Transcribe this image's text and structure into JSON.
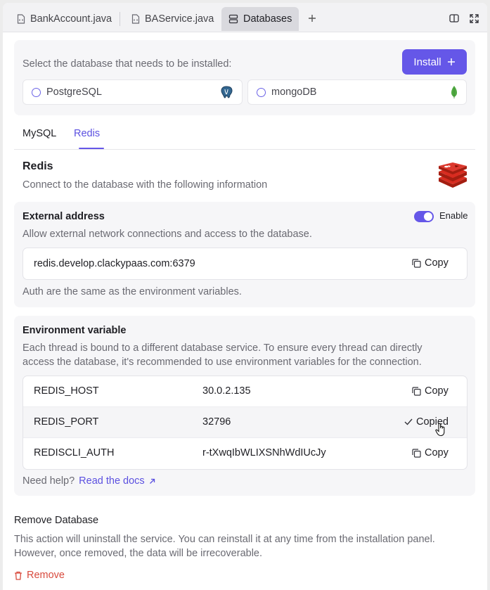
{
  "tabs": [
    {
      "label": "BankAccount.java",
      "icon": "file-code-icon"
    },
    {
      "label": "BAService.java",
      "icon": "file-code-icon"
    },
    {
      "label": "Databases",
      "icon": "database-icon"
    }
  ],
  "install": {
    "prompt": "Select the database that needs to be installed:",
    "button_label": "Install",
    "options": [
      {
        "label": "PostgreSQL",
        "icon": "postgresql-logo-icon"
      },
      {
        "label": "mongoDB",
        "icon": "mongodb-leaf-icon"
      }
    ]
  },
  "db_tabs": [
    "MySQL",
    "Redis"
  ],
  "selected_db_tab": "Redis",
  "redis": {
    "title": "Redis",
    "subtitle": "Connect to the database with the following information"
  },
  "external": {
    "title": "External address",
    "toggle_label": "Enable",
    "toggle_on": true,
    "description": "Allow external network connections and access to the database.",
    "address": "redis.develop.clackypaas.com:6379",
    "copy_label": "Copy",
    "note": "Auth are the same as the environment variables."
  },
  "env": {
    "title": "Environment variable",
    "description_line1": "Each thread is bound to a different database service. To ensure every thread can directly",
    "description_line2": "access the database, it's recommended to use environment variables for the connection.",
    "rows": [
      {
        "key": "REDIS_HOST",
        "value": "30.0.2.135",
        "action": "Copy"
      },
      {
        "key": "REDIS_PORT",
        "value": "32796",
        "action": "Copied"
      },
      {
        "key": "REDISCLI_AUTH",
        "value": "r-tXwqIbWLIXSNhWdIUcJy",
        "action": "Copy"
      }
    ],
    "help_text": "Need help?",
    "docs_link": "Read the docs"
  },
  "remove": {
    "title": "Remove Database",
    "description_line1": "This action will uninstall the service. You can reinstall it at any time from the installation panel.",
    "description_line2": "However, once removed, the data will be irrecoverable.",
    "button_label": "Remove"
  },
  "colors": {
    "accent": "#6557e8",
    "danger": "#d84a3d",
    "redis_red": "#c6302b",
    "mongo_green": "#4faa41"
  }
}
